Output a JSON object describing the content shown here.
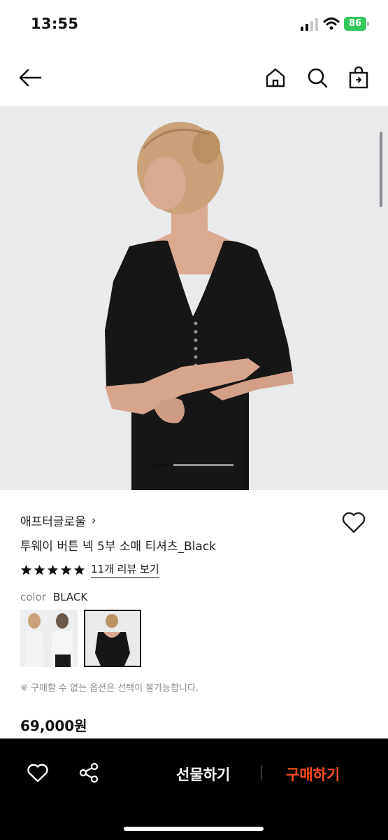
{
  "status_bar": {
    "time": "13:55",
    "battery": "86"
  },
  "nav": {
    "back_icon": "arrow-left-icon",
    "home_icon": "home-icon",
    "search_icon": "search-icon",
    "bag_icon": "shopping-bag-icon"
  },
  "product": {
    "brand": "애프터글로울",
    "brand_chevron": "›",
    "title": "투웨이 버튼 넥 5부 소매 티셔츠_Black",
    "rating_stars": 5,
    "review_link": "11개 리뷰 보기",
    "color_label": "color",
    "color_value": "BLACK",
    "notice": "※ 구매할 수 없는 옵션은 선택이 불가능합니다.",
    "price": "69,000원"
  },
  "bottom_bar": {
    "gift_label": "선물하기",
    "buy_label": "구매하기",
    "heart_icon": "heart-icon",
    "share_icon": "share-icon"
  },
  "colors": {
    "accent": "#ff4d1f",
    "star": "#111111",
    "battery": "#34c759"
  }
}
